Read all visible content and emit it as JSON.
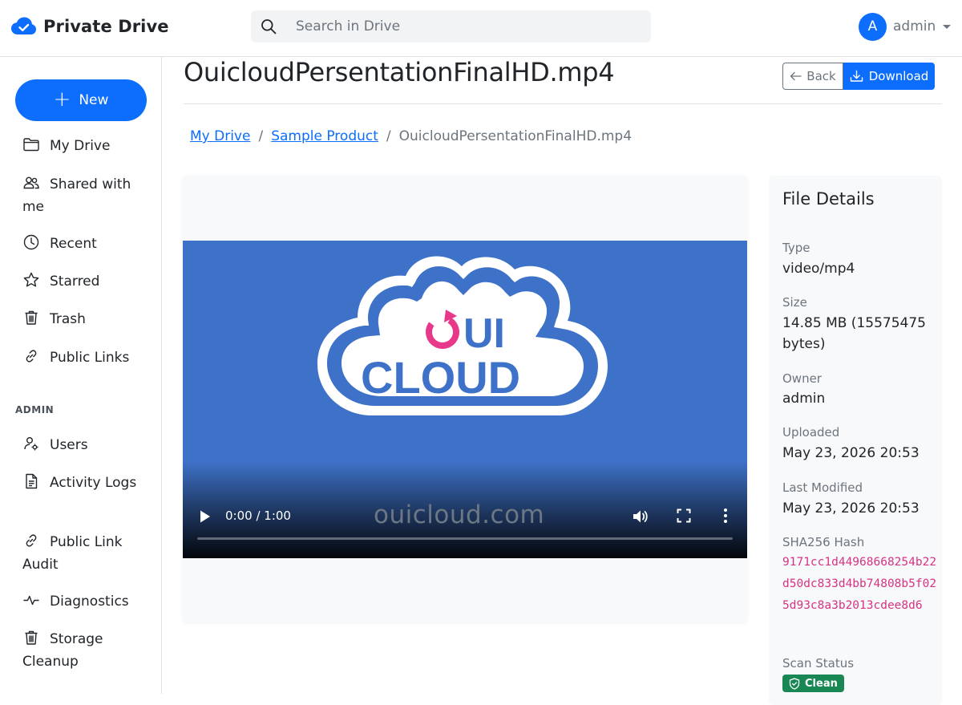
{
  "app": {
    "name": "Private Drive"
  },
  "search": {
    "placeholder": "Search in Drive"
  },
  "user": {
    "initial": "A",
    "name": "admin"
  },
  "sidebar": {
    "new_label": "New",
    "items": [
      {
        "label": "My Drive",
        "icon": "folder-icon"
      },
      {
        "label": "Shared with me",
        "icon": "people-icon"
      },
      {
        "label": "Recent",
        "icon": "clock-icon"
      },
      {
        "label": "Starred",
        "icon": "star-icon"
      },
      {
        "label": "Trash",
        "icon": "trash-icon"
      },
      {
        "label": "Public Links",
        "icon": "link-icon"
      }
    ],
    "admin_heading": "ADMIN",
    "admin_items": [
      {
        "label": "Users",
        "icon": "user-gear-icon"
      },
      {
        "label": "Activity Logs",
        "icon": "file-text-icon"
      },
      {
        "label": "Public Link Audit",
        "icon": "link-icon"
      },
      {
        "label": "Diagnostics",
        "icon": "pulse-icon"
      },
      {
        "label": "Storage Cleanup",
        "icon": "trash-icon"
      }
    ]
  },
  "file": {
    "title": "OuicloudPersentationFinalHD.mp4",
    "back_label": "Back",
    "download_label": "Download"
  },
  "breadcrumb": {
    "items": [
      "My Drive",
      "Sample Product"
    ],
    "current": "OuicloudPersentationFinalHD.mp4"
  },
  "video": {
    "logo_line1": "UI",
    "logo_line2": "CLOUD",
    "watermark": "ouicloud.com",
    "time": "0:00 / 1:00",
    "progress": 0
  },
  "details": {
    "heading": "File Details",
    "type_label": "Type",
    "type_value": "video/mp4",
    "size_label": "Size",
    "size_value": "14.85 MB (15575475 bytes)",
    "owner_label": "Owner",
    "owner_value": "admin",
    "uploaded_label": "Uploaded",
    "uploaded_value": "May 23, 2026 20:53",
    "modified_label": "Last Modified",
    "modified_value": "May 23, 2026 20:53",
    "hash_label": "SHA256 Hash",
    "hash_value": "9171cc1d44968668254b22d50dc833d4bb74808b5f025d93c8a3b2013cdee8d6",
    "scan_label": "Scan Status",
    "scan_value": "Clean"
  },
  "colors": {
    "primary": "#0d6efd",
    "success": "#198754",
    "hash": "#d63384",
    "video_bg": "#3e72c8",
    "logo_accent": "#e8388a"
  }
}
